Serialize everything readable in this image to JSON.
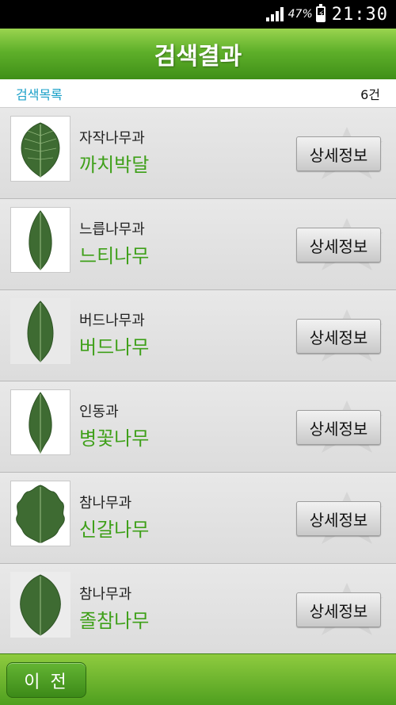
{
  "status_bar": {
    "battery_percent": "47%",
    "time": "21:30"
  },
  "title": "검색결과",
  "list_header": {
    "label": "검색목록",
    "count": "6건"
  },
  "detail_label": "상세정보",
  "items": [
    {
      "family": "자작나무과",
      "name": "까치박달",
      "leaf_icon": "leaf-icon"
    },
    {
      "family": "느릅나무과",
      "name": "느티나무",
      "leaf_icon": "leaf-icon"
    },
    {
      "family": "버드나무과",
      "name": "버드나무",
      "leaf_icon": "leaf-icon"
    },
    {
      "family": "인동과",
      "name": "병꽃나무",
      "leaf_icon": "leaf-icon"
    },
    {
      "family": "참나무과",
      "name": "신갈나무",
      "leaf_icon": "oak-leaf-icon"
    },
    {
      "family": "참나무과",
      "name": "졸참나무",
      "leaf_icon": "leaf-icon"
    }
  ],
  "bottom_bar": {
    "prev_label": "이 전"
  },
  "colors": {
    "accent_green": "#3fa01a",
    "header_blue": "#1aa0c8",
    "leaf_green": "#3e6b32"
  }
}
